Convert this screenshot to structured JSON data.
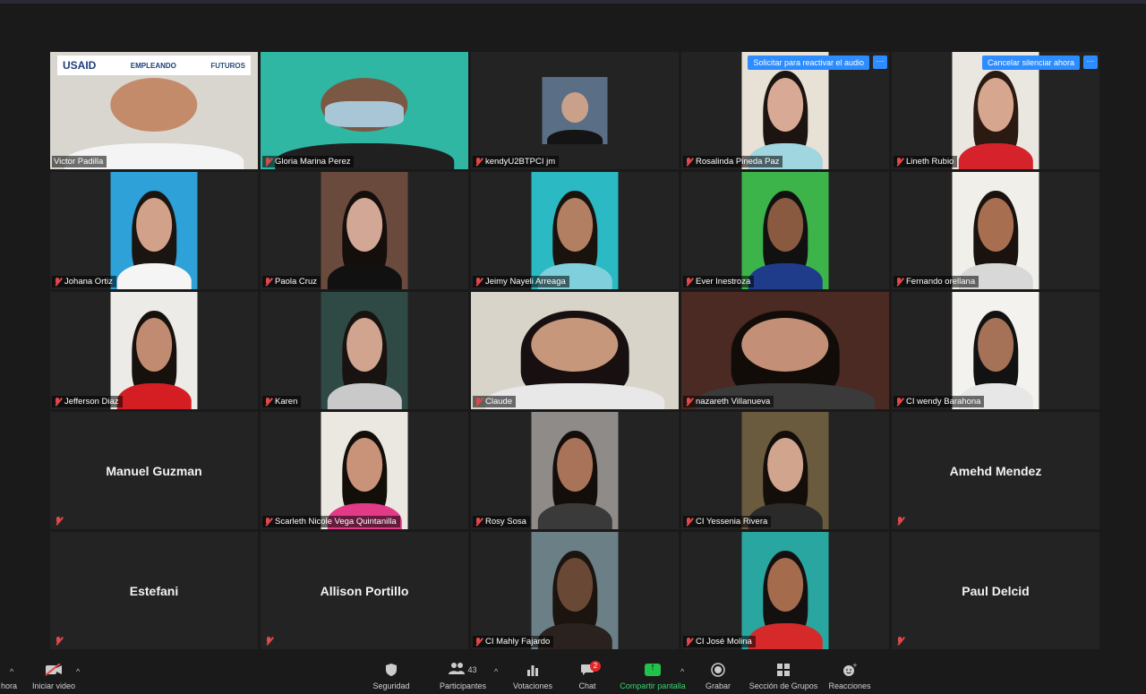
{
  "tiles": [
    {
      "name": "Victor Padilla",
      "active": true,
      "video": "wide",
      "bg": "#d8d6cf",
      "skin": "#c48b6a",
      "shirt": "#f4f4f4",
      "logos": [
        "USAID",
        "EMPLEANDO",
        "FUTUROS"
      ]
    },
    {
      "name": "Gloria Marina Perez",
      "video": "wide",
      "bg": "#2fb7a4",
      "skin": "#7a5844",
      "shirt": "#202020",
      "mask": true
    },
    {
      "name": "kendyU2BTPCI jm",
      "video": "small",
      "bg": "#5a6e85",
      "skin": "#c9a08a",
      "shirt": "#141414"
    },
    {
      "name": "Rosalinda Pineda Paz",
      "video": "normal",
      "bg": "#e8e1d6",
      "skin": "#d8a995",
      "shirt": "#9fd6e0",
      "hair": "#1c1410",
      "badge": "Solicitar para reactivar el audio"
    },
    {
      "name": "Lineth Rubio",
      "video": "normal",
      "bg": "#e9e7e0",
      "skin": "#d7a68e",
      "shirt": "#d5222b",
      "hair": "#2a1a12",
      "badge": "Cancelar silenciar ahora"
    },
    {
      "name": "Johana Ortiz",
      "video": "normal",
      "bg": "#2ea1d8",
      "skin": "#d1a189",
      "shirt": "#f5f5f5",
      "hair": "#1b1511"
    },
    {
      "name": "Paola Cruz",
      "video": "normal",
      "bg": "#6b4a3e",
      "skin": "#d3a795",
      "shirt": "#111111",
      "hair": "#150f0c"
    },
    {
      "name": "Jeimy Nayeli Arreaga",
      "video": "normal",
      "bg": "#2bb9c4",
      "skin": "#b27f63",
      "shirt": "#7fd0dc",
      "hair": "#1a120d"
    },
    {
      "name": "Ever Inestroza",
      "video": "normal",
      "bg": "#3db44a",
      "skin": "#8a5a40",
      "shirt": "#1f3c8a",
      "hair": "#111111"
    },
    {
      "name": "Fernando orellana",
      "video": "normal",
      "bg": "#f1efe9",
      "skin": "#a86e50",
      "shirt": "#d8d8d8",
      "hair": "#1a120e"
    },
    {
      "name": "Jefferson Diaz",
      "video": "normal",
      "bg": "#ecebe7",
      "skin": "#c08b70",
      "shirt": "#d51d24",
      "hair": "#17110d"
    },
    {
      "name": "Karen",
      "video": "normal",
      "bg": "#2f4a45",
      "skin": "#d1a48f",
      "shirt": "#c9c9c9",
      "hair": "#181210"
    },
    {
      "name": "Claude",
      "video": "wide",
      "bg": "#d9d4c9",
      "skin": "#c7977c",
      "shirt": "#e8e8e8",
      "hair": "#181010"
    },
    {
      "name": "nazareth Villanueva",
      "video": "wide",
      "bg": "#4a2a22",
      "skin": "#c39077",
      "shirt": "#3a3a3a",
      "hair": "#120c09"
    },
    {
      "name": "CI wendy Barahona",
      "video": "normal",
      "bg": "#f4f2ee",
      "skin": "#a57258",
      "shirt": "#e7e7e7",
      "hair": "#121212"
    },
    {
      "name": "Manuel Guzman",
      "video": "none"
    },
    {
      "name": "Scarleth Nicole Vega Quintanilla",
      "video": "normal",
      "bg": "#ebe8e2",
      "skin": "#c99379",
      "shirt": "#e23a86",
      "hair": "#140e0a"
    },
    {
      "name": "Rosy Sosa",
      "video": "normal",
      "bg": "#8f8b88",
      "skin": "#a9735a",
      "shirt": "#3a3a3a",
      "hair": "#140e0b"
    },
    {
      "name": "CI Yessenia Rivera",
      "video": "normal",
      "bg": "#6a5a3e",
      "skin": "#d0a48d",
      "shirt": "#2a2a2a",
      "hair": "#140e0a"
    },
    {
      "name": "Amehd Mendez",
      "video": "none"
    },
    {
      "name": "Estefani",
      "video": "none"
    },
    {
      "name": "Allison Portillo",
      "video": "none"
    },
    {
      "name": "CI Mahly Fajardo",
      "video": "normal",
      "bg": "#6b7f86",
      "skin": "#6a4836",
      "shirt": "#2a221e",
      "hair": "#1c140f"
    },
    {
      "name": "CI José Molina",
      "video": "normal",
      "bg": "#2aa6a0",
      "skin": "#a56b4d",
      "shirt": "#d62a2a",
      "hair": "#141010"
    },
    {
      "name": "Paul Delcid",
      "video": "none"
    }
  ],
  "toolbar": {
    "left_label": "hora",
    "video_label": "Iniciar video",
    "security_label": "Seguridad",
    "participants_label": "Participantes",
    "participants_count": "43",
    "polls_label": "Votaciones",
    "chat_label": "Chat",
    "chat_badge": "2",
    "share_label": "Compartir pantalla",
    "record_label": "Grabar",
    "breakout_label": "Sección de Grupos",
    "reactions_label": "Reacciones"
  },
  "colors": {
    "accent": "#2d8cff",
    "active_border": "#d7e23a",
    "share_green": "#21c24a",
    "mute_red": "#e04848"
  }
}
